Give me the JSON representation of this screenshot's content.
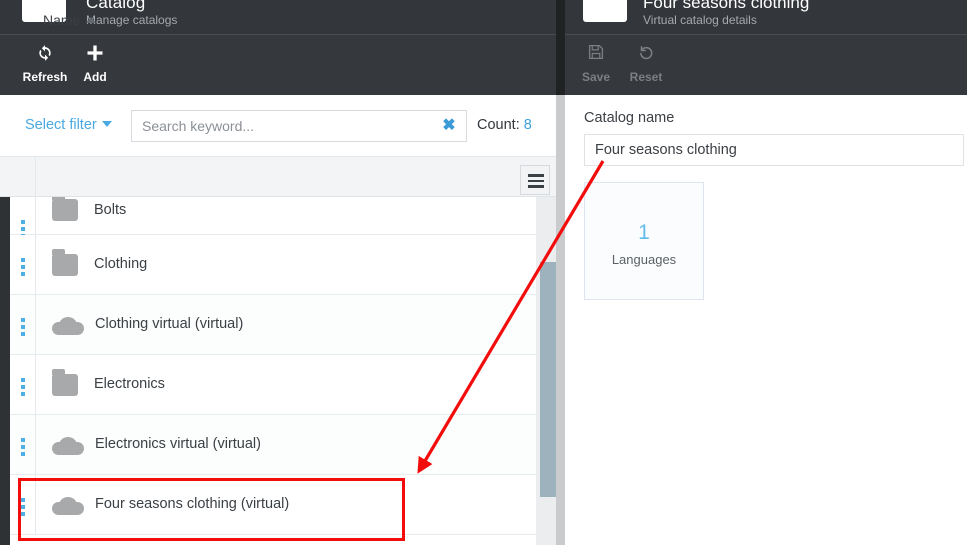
{
  "left": {
    "header": {
      "title": "Catalog",
      "subtitle": "Manage catalogs",
      "icon": "folder-icon"
    },
    "toolbar": [
      {
        "label": "Refresh",
        "icon": "refresh-icon",
        "glyph": "⟳"
      },
      {
        "label": "Add",
        "icon": "plus-icon",
        "glyph": "＋"
      }
    ],
    "filterbar": {
      "select_filter_label": "Select filter",
      "search_placeholder": "Search keyword...",
      "search_value": "",
      "clear_icon": "clear-x-icon",
      "count_label": "Count:",
      "count_value": "8"
    },
    "grid": {
      "column_header": "Name",
      "sort_direction": "ascending",
      "menu_icon": "hamburger-icon",
      "rows": [
        {
          "name": "Bolts",
          "icon": "folder-icon",
          "virtual": false,
          "selected": false
        },
        {
          "name": "Clothing",
          "icon": "folder-icon",
          "virtual": false,
          "selected": false
        },
        {
          "name": "Clothing virtual (virtual)",
          "icon": "cloud-icon",
          "virtual": true,
          "selected": false
        },
        {
          "name": "Electronics",
          "icon": "folder-icon",
          "virtual": false,
          "selected": false
        },
        {
          "name": "Electronics virtual (virtual)",
          "icon": "cloud-icon",
          "virtual": true,
          "selected": false
        },
        {
          "name": "Four seasons clothing (virtual)",
          "icon": "cloud-icon",
          "virtual": true,
          "selected": true
        }
      ]
    }
  },
  "right": {
    "header": {
      "title": "Four seasons clothing",
      "subtitle": "Virtual catalog details",
      "icon": "folder-icon"
    },
    "toolbar": [
      {
        "label": "Save",
        "icon": "save-disk-icon",
        "glyph": "💾",
        "disabled": true
      },
      {
        "label": "Reset",
        "icon": "undo-arrow-icon",
        "glyph": "↺",
        "disabled": true
      }
    ],
    "form": {
      "catalog_name_label": "Catalog name",
      "catalog_name_value": "Four seasons clothing"
    },
    "cards": [
      {
        "count": "1",
        "label": "Languages"
      }
    ]
  },
  "colors": {
    "header_dark": "#33363a",
    "toolbar_dark": "#35383c",
    "accent_blue": "#49a9e0",
    "annotation_red": "#f30c0c",
    "icon_gray": "#a8a9ab",
    "scrollbar_thumb": "#9eb2be"
  }
}
